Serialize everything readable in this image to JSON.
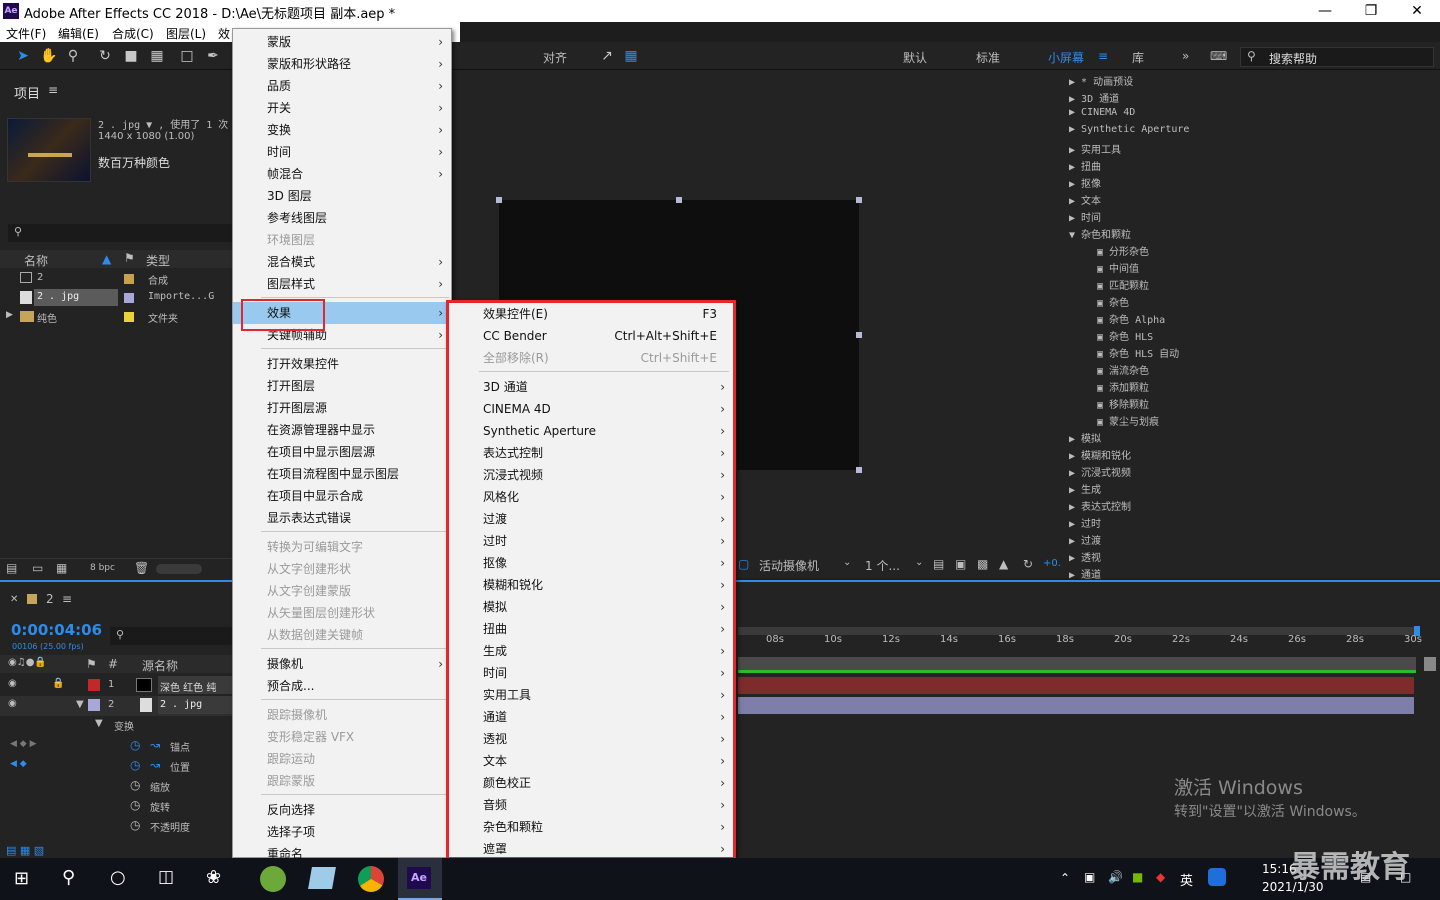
{
  "window": {
    "title": "Adobe After Effects CC 2018 - D:\\Ae\\无标题项目 副本.aep *",
    "logo": "Ae"
  },
  "menubar": [
    "文件(F)",
    "编辑(E)",
    "合成(C)",
    "图层(L)",
    "效"
  ],
  "toolbar": {
    "align": "对齐",
    "workspaces": [
      "默认",
      "标准",
      "小屏幕",
      "库"
    ],
    "search_placeholder": "搜索帮助"
  },
  "project": {
    "title": "项目",
    "asset_name": "2 . jpg ▼ , 使用了 1 次",
    "asset_dims": "1440 x 1080 (1.00)",
    "asset_color": "数百万种颜色",
    "columns": [
      "名称",
      "类型"
    ],
    "rows": [
      {
        "name": "2",
        "type": "合成"
      },
      {
        "name": "2 . jpg",
        "type": "Importe...G"
      },
      {
        "name": "纯色",
        "type": "文件夹"
      }
    ],
    "bpc": "8 bpc"
  },
  "comp": {
    "camera": "活动摄像机",
    "views": "1 个...",
    "offset": "+0."
  },
  "effects_list": [
    "* 动画预设",
    "3D 通道",
    "CINEMA 4D",
    "Synthetic Aperture",
    "实用工具",
    "扭曲",
    "抠像",
    "文本",
    "时间",
    "杂色和颗粒",
    "分形杂色",
    "中间值",
    "匹配颗粒",
    "杂色",
    "杂色 Alpha",
    "杂色 HLS",
    "杂色 HLS 自动",
    "湍流杂色",
    "添加颗粒",
    "移除颗粒",
    "蒙尘与划痕",
    "模拟",
    "模糊和锐化",
    "沉浸式视频",
    "生成",
    "表达式控制",
    "过时",
    "过渡",
    "透视",
    "通道"
  ],
  "timeline": {
    "comp_tab": "2",
    "timecode": "0:00:04:06",
    "fps": "00106 (25.00 fps)",
    "col_source": "源名称",
    "layers": [
      {
        "num": "1",
        "name": "深色 红色 纯"
      },
      {
        "num": "2",
        "name": "2 . jpg"
      }
    ],
    "transform": "变换",
    "props": [
      "锚点",
      "位置",
      "缩放",
      "旋转",
      "不透明度"
    ],
    "ticks": [
      "08s",
      "10s",
      "12s",
      "14s",
      "16s",
      "18s",
      "20s",
      "22s",
      "24s",
      "26s",
      "28s",
      "30s"
    ]
  },
  "context_menu": [
    {
      "label": "蒙版",
      "arrow": true
    },
    {
      "label": "蒙版和形状路径",
      "arrow": true
    },
    {
      "label": "品质",
      "arrow": true
    },
    {
      "label": "开关",
      "arrow": true
    },
    {
      "label": "变换",
      "arrow": true
    },
    {
      "label": "时间",
      "arrow": true
    },
    {
      "label": "帧混合",
      "arrow": true
    },
    {
      "label": "3D 图层"
    },
    {
      "label": "参考线图层"
    },
    {
      "label": "环境图层",
      "disabled": true
    },
    {
      "label": "混合模式",
      "arrow": true
    },
    {
      "label": "图层样式",
      "arrow": true
    },
    {
      "label": "效果",
      "arrow": true,
      "highlight": true
    },
    {
      "label": "关键帧辅助",
      "arrow": true
    },
    {
      "label": "打开效果控件"
    },
    {
      "label": "打开图层"
    },
    {
      "label": "打开图层源"
    },
    {
      "label": "在资源管理器中显示"
    },
    {
      "label": "在项目中显示图层源"
    },
    {
      "label": "在项目流程图中显示图层"
    },
    {
      "label": "在项目中显示合成"
    },
    {
      "label": "显示表达式错误"
    },
    {
      "label": "转换为可编辑文字",
      "disabled": true
    },
    {
      "label": "从文字创建形状",
      "disabled": true
    },
    {
      "label": "从文字创建蒙版",
      "disabled": true
    },
    {
      "label": "从矢量图层创建形状",
      "disabled": true
    },
    {
      "label": "从数据创建关键帧",
      "disabled": true
    },
    {
      "label": "摄像机",
      "arrow": true
    },
    {
      "label": "预合成..."
    },
    {
      "label": "跟踪摄像机",
      "disabled": true
    },
    {
      "label": "变形稳定器 VFX",
      "disabled": true
    },
    {
      "label": "跟踪运动",
      "disabled": true
    },
    {
      "label": "跟踪蒙版",
      "disabled": true
    },
    {
      "label": "反向选择"
    },
    {
      "label": "选择子项"
    },
    {
      "label": "重命名"
    }
  ],
  "submenu": [
    {
      "label": "效果控件(E)",
      "shortcut": "F3"
    },
    {
      "label": "CC Bender",
      "shortcut": "Ctrl+Alt+Shift+E"
    },
    {
      "label": "全部移除(R)",
      "shortcut": "Ctrl+Shift+E",
      "disabled": true
    },
    {
      "label": "3D 通道",
      "arrow": true
    },
    {
      "label": "CINEMA 4D",
      "arrow": true
    },
    {
      "label": "Synthetic Aperture",
      "arrow": true
    },
    {
      "label": "表达式控制",
      "arrow": true
    },
    {
      "label": "沉浸式视频",
      "arrow": true
    },
    {
      "label": "风格化",
      "arrow": true
    },
    {
      "label": "过渡",
      "arrow": true
    },
    {
      "label": "过时",
      "arrow": true
    },
    {
      "label": "抠像",
      "arrow": true
    },
    {
      "label": "模糊和锐化",
      "arrow": true
    },
    {
      "label": "模拟",
      "arrow": true
    },
    {
      "label": "扭曲",
      "arrow": true
    },
    {
      "label": "生成",
      "arrow": true
    },
    {
      "label": "时间",
      "arrow": true
    },
    {
      "label": "实用工具",
      "arrow": true
    },
    {
      "label": "通道",
      "arrow": true
    },
    {
      "label": "透视",
      "arrow": true
    },
    {
      "label": "文本",
      "arrow": true
    },
    {
      "label": "颜色校正",
      "arrow": true
    },
    {
      "label": "音频",
      "arrow": true
    },
    {
      "label": "杂色和颗粒",
      "arrow": true
    },
    {
      "label": "遮罩",
      "arrow": true
    }
  ],
  "watermark": {
    "line1": "激活 Windows",
    "line2": "转到\"设置\"以激活 Windows。",
    "brand": "暴需教育"
  },
  "taskbar": {
    "time": "15:16",
    "date": "2021/1/30",
    "ime": "英",
    "ae": "Ae"
  },
  "colors": {
    "accent": "#2d8ceb",
    "highlight_box": "#e5262b",
    "menu_bg": "#f2f2f2"
  }
}
